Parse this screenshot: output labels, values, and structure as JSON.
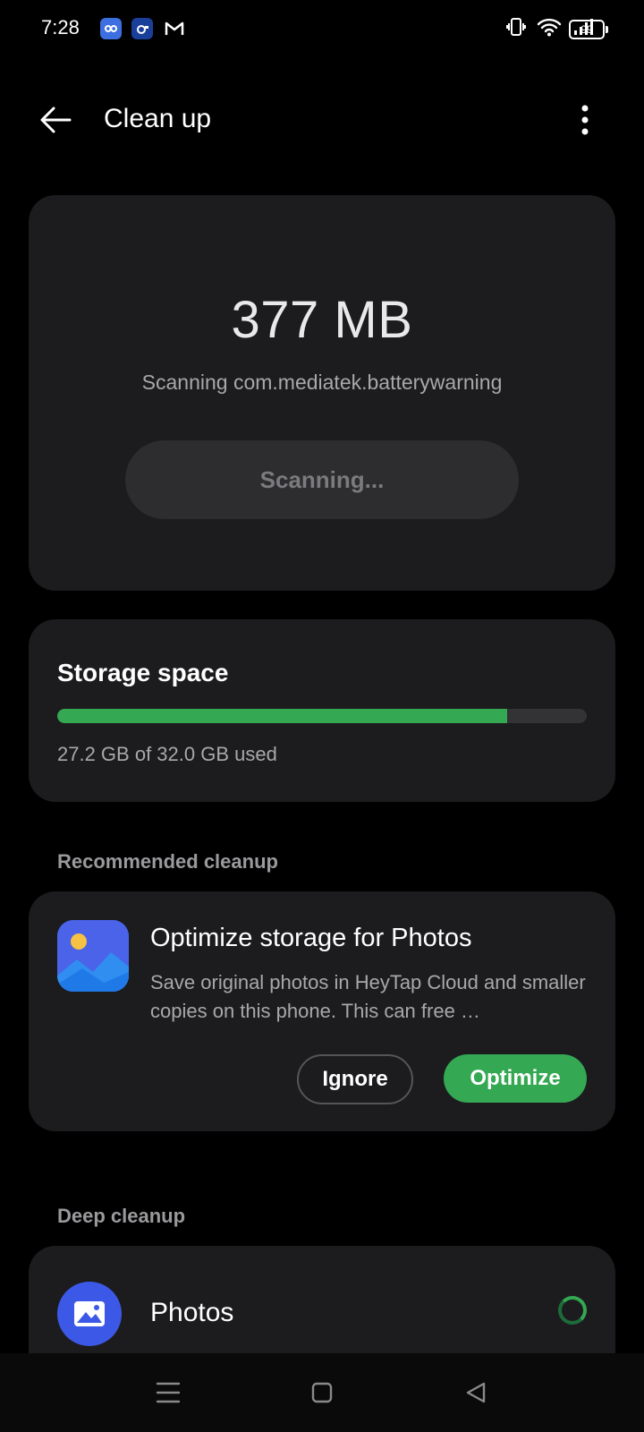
{
  "status_bar": {
    "time": "7:28",
    "battery": "99",
    "app_icons": [
      "infinity-app-icon",
      "camera-app-icon",
      "gmail-icon"
    ],
    "system_icons": [
      "vibrate-icon",
      "wifi-icon",
      "signal-icon",
      "battery-icon"
    ]
  },
  "app_bar": {
    "title": "Clean up",
    "back_icon": "arrow-left-icon",
    "more_icon": "more-vertical-icon"
  },
  "scan": {
    "size": "377 MB",
    "status": "Scanning com.mediatek.batterywarning",
    "button_label": "Scanning..."
  },
  "storage": {
    "title": "Storage space",
    "used_text": "27.2 GB of 32.0 GB used",
    "used_fraction": 0.85,
    "bar_color": "#34a853"
  },
  "recommended": {
    "section_label": "Recommended cleanup",
    "item": {
      "title": "Optimize storage for Photos",
      "description": "Save original photos in HeyTap Cloud and smaller copies on this phone. This can free …",
      "ignore_label": "Ignore",
      "optimize_label": "Optimize",
      "icon": "photos-app-icon"
    }
  },
  "deep_cleanup": {
    "section_label": "Deep cleanup",
    "items": [
      {
        "title": "Photos",
        "icon": "image-icon",
        "state": "loading"
      }
    ]
  },
  "nav_bar": {
    "buttons": [
      "menu-icon",
      "home-icon",
      "back-triangle-icon"
    ]
  },
  "colors": {
    "accent": "#34a853",
    "card_bg": "#1c1c1e",
    "background": "#000000"
  }
}
